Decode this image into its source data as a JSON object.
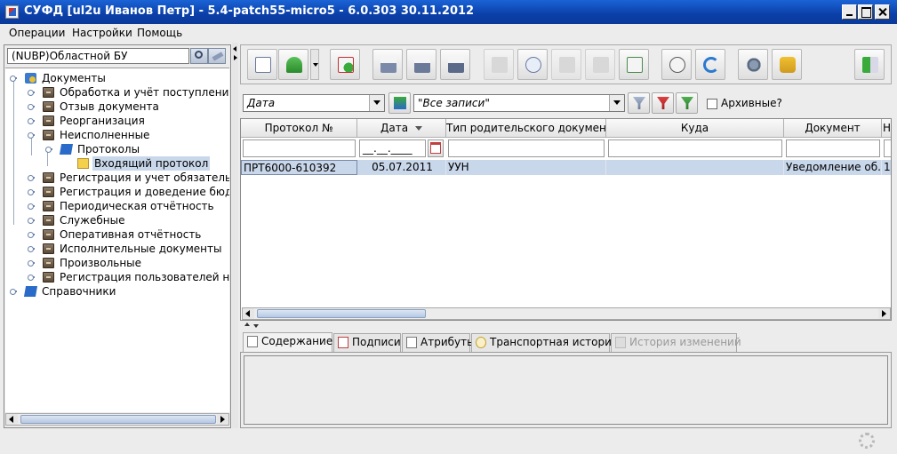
{
  "window": {
    "title": "СУФД [ul2u Иванов Петр] - 5.4-patch55-micro5 - 6.0.303 30.11.2012"
  },
  "menu": {
    "items": [
      "Операции",
      "Настройки",
      "Помощь"
    ]
  },
  "org": {
    "value": "(NUBP)Областной БУ"
  },
  "tree": {
    "root": "Документы",
    "items": [
      "Обработка и учёт поступлений",
      "Отзыв документа",
      "Реорганизация",
      "Неисполненные",
      "Протоколы",
      "Входящий протокол",
      "Регистрация и учет обязательств",
      "Регистрация и доведение бюджет",
      "Периодическая отчётность",
      "Служебные",
      "Оперативная отчётность",
      "Исполнительные документы",
      "Произвольные",
      "Регистрация пользователей на о"
    ],
    "root2": "Справочники"
  },
  "filter": {
    "sort_field": "Дата",
    "records": "\"Все записи\"",
    "archive_label": "Архивные?"
  },
  "table": {
    "columns": [
      "Протокол №",
      "Дата",
      "Тип родительского документа",
      "Куда",
      "Документ",
      "Н"
    ],
    "date_placeholder": "__.__.____",
    "rows": [
      {
        "num": "ПРТ6000-610392",
        "date": "05.07.2011",
        "type": "УУН",
        "dest": "",
        "doc": "Уведомление об...",
        "n": "1"
      }
    ]
  },
  "tabs": [
    "Содержание",
    "Подписи",
    "Атрибуты",
    "Транспортная история",
    "История изменений"
  ]
}
